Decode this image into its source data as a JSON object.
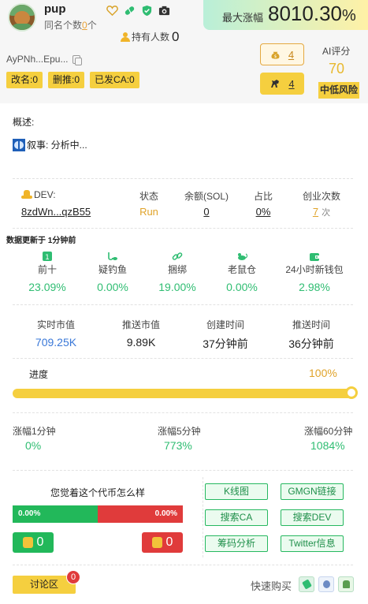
{
  "token": {
    "name": "pup",
    "same_name_prefix": "同名个数",
    "same_name_count": "0",
    "same_name_suffix": "个",
    "holders_label": "持有人数",
    "holders_count": "0",
    "address": "AyPNh...Epu...",
    "max_gain_label": "最大涨幅",
    "max_gain_value": "8010.30",
    "max_gain_unit": "%"
  },
  "header_icons": [
    "heart-icon",
    "pill-icon",
    "shield-check-icon",
    "camera-icon"
  ],
  "chips": [
    {
      "name": "rename-chip",
      "label": "改名:0"
    },
    {
      "name": "deleted-push-chip",
      "label": "删推:0"
    },
    {
      "name": "issued-ca-chip",
      "label": "已发CA:0"
    }
  ],
  "side_buttons": {
    "bag_count": "4",
    "horse_count": "4"
  },
  "ai": {
    "label": "AI评分",
    "score": "70",
    "risk": "中低风险"
  },
  "summary": {
    "title": "概述:",
    "narrative": "叙事: 分析中..."
  },
  "dev": {
    "label": "DEV:",
    "address": "8zdWn...qzB55",
    "status_label": "状态",
    "status_value": "Run",
    "balance_label": "余额(SOL)",
    "balance_value": "0",
    "share_label": "占比",
    "share_value": "0%",
    "startups_label": "创业次数",
    "startups_value": "7",
    "startups_unit": "次"
  },
  "update_note": "数据更新于 1分钟前",
  "metrics": [
    {
      "name": "top10",
      "label": "前十",
      "value": "23.09%",
      "icon": "top10-icon"
    },
    {
      "name": "fishing",
      "label": "疑钓鱼",
      "value": "0.00%",
      "icon": "fishing-icon"
    },
    {
      "name": "bundle",
      "label": "捆绑",
      "value": "19.00%",
      "icon": "link-icon"
    },
    {
      "name": "rat",
      "label": "老鼠仓",
      "value": "0.00%",
      "icon": "rat-icon"
    },
    {
      "name": "new-wallet",
      "label": "24小时新钱包",
      "value": "2.98%",
      "icon": "wallet-icon"
    }
  ],
  "market": [
    {
      "name": "realtime-mcap",
      "label": "实时市值",
      "value": "709.25K"
    },
    {
      "name": "push-mcap",
      "label": "推送市值",
      "value": "9.89K"
    },
    {
      "name": "created-time",
      "label": "创建时间",
      "value": "37分钟前"
    },
    {
      "name": "push-time",
      "label": "推送时间",
      "value": "36分钟前"
    }
  ],
  "progress": {
    "label": "进度",
    "value_text": "100%",
    "fraction": 1.0
  },
  "gains": [
    {
      "name": "gain-1m",
      "label": "涨幅1分钟",
      "value": "0%"
    },
    {
      "name": "gain-5m",
      "label": "涨幅5分钟",
      "value": "773%"
    },
    {
      "name": "gain-60m",
      "label": "涨幅60分钟",
      "value": "1084%"
    }
  ],
  "vote": {
    "question": "您觉着这个代币怎么样",
    "bull_pct": "0.00%",
    "bear_pct": "0.00%",
    "up_count": "0",
    "down_count": "0"
  },
  "links": [
    {
      "name": "kline-button",
      "label": "K线图"
    },
    {
      "name": "gmgn-link-button",
      "label": "GMGN链接"
    },
    {
      "name": "search-ca-button",
      "label": "搜索CA"
    },
    {
      "name": "search-dev-button",
      "label": "搜索DEV"
    },
    {
      "name": "chip-analysis-button",
      "label": "筹码分析"
    },
    {
      "name": "twitter-info-button",
      "label": "Twitter信息"
    }
  ],
  "footer": {
    "discuss_label": "讨论区",
    "discuss_badge": "0",
    "quick_buy_label": "快速购买",
    "quick_icons": [
      "bot-1-icon",
      "bot-2-icon",
      "bot-3-icon"
    ]
  },
  "colors": {
    "accent_yellow": "#f5cf3f",
    "green": "#2fbd72",
    "red": "#e03b3b",
    "blue": "#3a78d8"
  }
}
